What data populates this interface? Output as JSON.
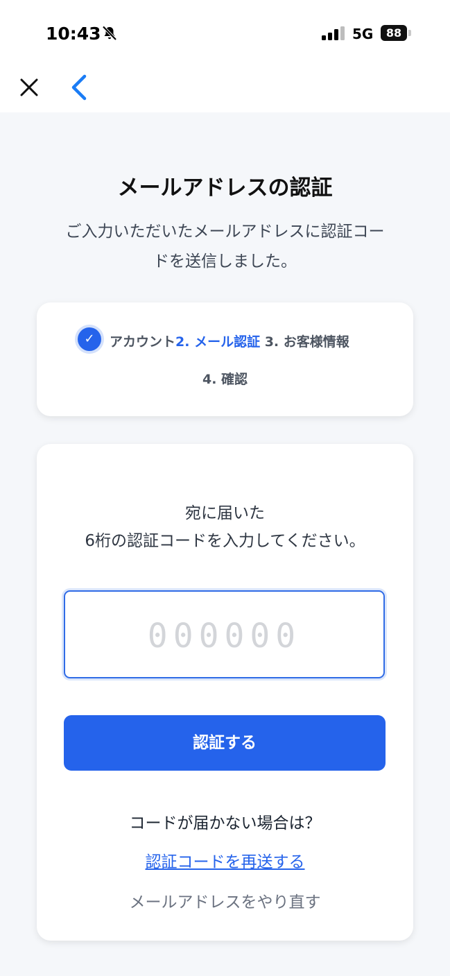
{
  "status_bar": {
    "time": "10:43",
    "network": "5G",
    "battery": "88",
    "icons": [
      "bell-slash-icon",
      "signal-icon",
      "battery-icon"
    ]
  },
  "nav": {
    "close_icon": "close-icon",
    "back_icon": "chevron-left-icon"
  },
  "header": {
    "title": "メールアドレスの認証",
    "subtitle_line1": "ご入力いただいたメールアドレスに認証コー",
    "subtitle_line2": "ドを送信しました。"
  },
  "steps": {
    "step1": "アカウント",
    "step2": "2. メール認証",
    "step3": "3. お客様情報",
    "step4": "4. 確認",
    "check_glyph": "✓"
  },
  "verification": {
    "instruction_line1": "宛に届いた",
    "instruction_line2": "6桁の認証コードを入力してください。",
    "code_placeholder": "000000",
    "verify_label": "認証する",
    "no_code_text": "コードが届かない場合は？",
    "resend_label": "認証コードを再送する",
    "redo_label": "メールアドレスをやり直す"
  },
  "colors": {
    "primary": "#2563eb",
    "background": "#f5f7fa",
    "placeholder": "#d3d5d9"
  }
}
